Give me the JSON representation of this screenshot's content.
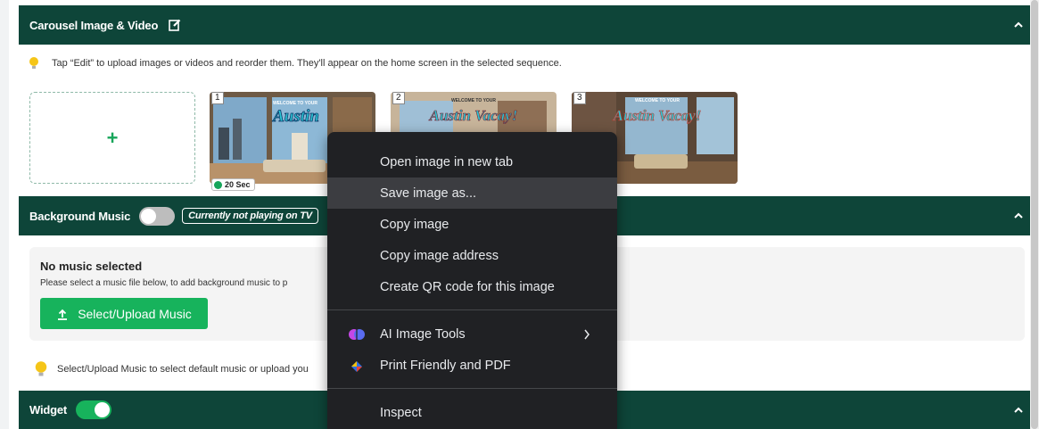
{
  "carousel": {
    "title": "Carousel Image & Video",
    "tip": "Tap “Edit” to upload images or videos and reorder them. They'll appear on the home screen in the selected sequence.",
    "add_symbol": "+",
    "thumbnails": [
      {
        "number": "1",
        "duration": "20 Sec",
        "heading": "WELCOME TO YOUR",
        "brand": "Austin"
      },
      {
        "number": "2",
        "heading": "WELCOME TO YOUR",
        "brand": "Austin Vacay!"
      },
      {
        "number": "3",
        "heading": "WELCOME TO YOUR",
        "brand": "Austin Vacay!"
      }
    ]
  },
  "background_music": {
    "title": "Background Music",
    "toggle_state": "off",
    "status": "Currently not playing on TV",
    "card_title": "No music selected",
    "card_desc": "Please select a music file below, to add background music to p",
    "upload_button": "Select/Upload Music",
    "tip": "Select/Upload Music to select default music or upload you"
  },
  "widget": {
    "title": "Widget",
    "toggle_state": "on"
  },
  "context_menu": {
    "items": [
      {
        "label": "Open image in new tab"
      },
      {
        "label": "Save image as..."
      },
      {
        "label": "Copy image"
      },
      {
        "label": "Copy image address"
      },
      {
        "label": "Create QR code for this image"
      }
    ],
    "extensions": [
      {
        "label": "AI Image Tools",
        "icon": "brain-icon"
      },
      {
        "label": "Print Friendly and PDF",
        "icon": "print-friendly-icon"
      }
    ],
    "inspect": "Inspect"
  },
  "colors": {
    "header_bg": "#0e4539",
    "accent_green": "#17b35c",
    "menu_bg": "#202124",
    "menu_highlight": "#3c3d41"
  }
}
